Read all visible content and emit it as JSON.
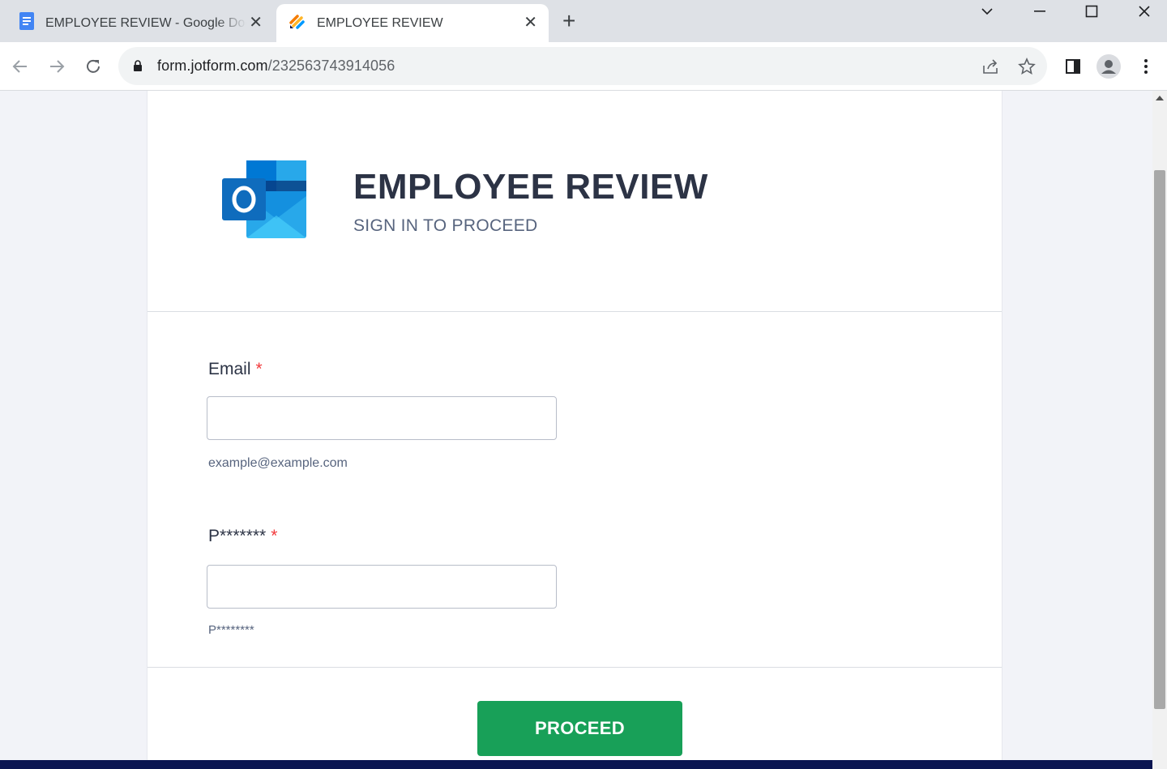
{
  "browser": {
    "tabs": [
      {
        "title": "EMPLOYEE REVIEW - Google Docs",
        "icon": "google-docs-icon",
        "close": "✕"
      },
      {
        "title": "EMPLOYEE REVIEW",
        "icon": "jotform-icon",
        "close": "✕"
      }
    ],
    "new_tab": "+",
    "url_host": "form.jotform.com",
    "url_path": "/232563743914056"
  },
  "form": {
    "title": "EMPLOYEE REVIEW",
    "subtitle": "SIGN IN TO PROCEED",
    "email": {
      "label": "Email",
      "required_mark": "*",
      "value": "",
      "sublabel": "example@example.com"
    },
    "password": {
      "label": "P*******",
      "required_mark": "*",
      "value": "",
      "sublabel": "P********"
    },
    "submit_label": "PROCEED"
  },
  "colors": {
    "submit": "#18a058",
    "title": "#2c3345",
    "required": "#f23a3c",
    "footer": "#0a1551"
  }
}
